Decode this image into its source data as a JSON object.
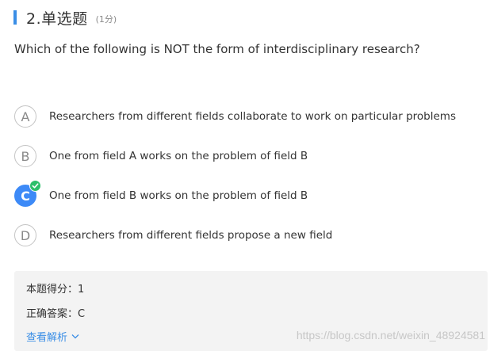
{
  "question": {
    "number_label": "2.单选题",
    "score_label": "(1分)",
    "text": "Which of the following is NOT the form of interdisciplinary research?"
  },
  "options": [
    {
      "letter": "A",
      "label": "Researchers from different fields collaborate to work on particular problems",
      "selected": false
    },
    {
      "letter": "B",
      "label": "One from field A works on the problem of field B",
      "selected": false
    },
    {
      "letter": "C",
      "label": "One from field B works on the problem of field B",
      "selected": true
    },
    {
      "letter": "D",
      "label": "Researchers from different fields propose a new field",
      "selected": false
    }
  ],
  "result": {
    "score_line": "本题得分：1",
    "answer_line": "正确答案：C",
    "analysis_label": "查看解析"
  },
  "watermark": "https://blog.csdn.net/weixin_48924581",
  "colors": {
    "accent": "#3a8ee6",
    "selected_option": "#3d8af7",
    "correct_check": "#2bbf6a"
  },
  "icons": {
    "selected_indicator": "check-icon",
    "analysis_toggle": "chevron-down-icon"
  }
}
